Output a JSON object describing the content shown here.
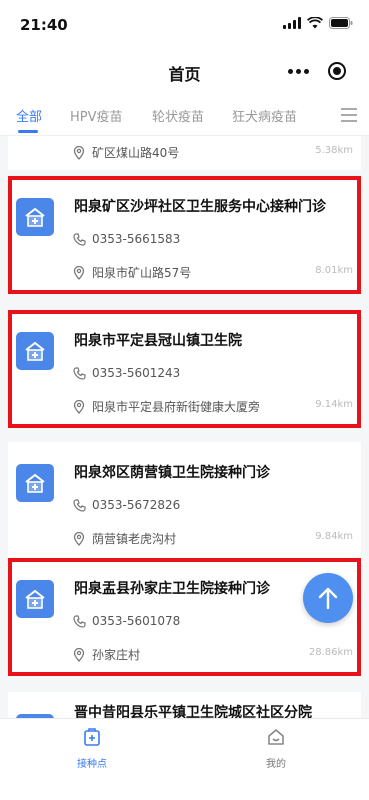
{
  "status_bar": {
    "time": "21:40"
  },
  "nav": {
    "title": "首页"
  },
  "tabs": [
    {
      "label": "全部",
      "active": true
    },
    {
      "label": "HPV疫苗",
      "active": false
    },
    {
      "label": "轮状疫苗",
      "active": false
    },
    {
      "label": "狂犬病疫苗",
      "active": false
    }
  ],
  "partial_item": {
    "address": "矿区煤山路40号",
    "distance": "5.38km"
  },
  "clinics": [
    {
      "name": "阳泉矿区沙坪社区卫生服务中心接种门诊",
      "phone": "0353-5661583",
      "address": "阳泉市矿山路57号",
      "distance": "8.01km",
      "highlighted": true
    },
    {
      "name": "阳泉市平定县冠山镇卫生院",
      "phone": "0353-5601243",
      "address": "阳泉市平定县府新街健康大厦旁",
      "distance": "9.14km",
      "highlighted": true
    },
    {
      "name": "阳泉郊区荫营镇卫生院接种门诊",
      "phone": "0353-5672826",
      "address": "荫营镇老虎沟村",
      "distance": "9.84km",
      "highlighted": false
    },
    {
      "name": "阳泉盂县孙家庄卫生院接种门诊",
      "phone": "0353-5601078",
      "address": "孙家庄村",
      "distance": "28.86km",
      "highlighted": true
    },
    {
      "name": "晋中昔阳县乐平镇卫生院城区社区分院",
      "phone": "",
      "address": "",
      "distance": "",
      "highlighted": false
    }
  ],
  "bottom_nav": [
    {
      "label": "接种点",
      "active": true
    },
    {
      "label": "我的",
      "active": false
    }
  ],
  "colors": {
    "accent": "#3a7bf5",
    "highlight_border": "#e8131a",
    "icon_bg": "#4b87e8"
  }
}
